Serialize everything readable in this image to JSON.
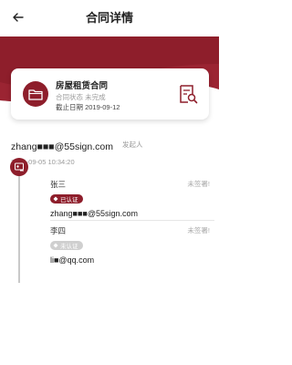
{
  "header": {
    "title": "合同详情"
  },
  "contract": {
    "name": "房屋租赁合同",
    "status": "合同状态 未完成",
    "deadline": "截止日期 2019-09-12"
  },
  "initiator": {
    "email": "zhang■■■@55sign.com",
    "label": "发起人",
    "created_time": "2019-09-05 10:34:20"
  },
  "signers": [
    {
      "name": "张三",
      "badge": "已认证",
      "contact": "zhang■■■@55sign.com",
      "state": "未签署!"
    },
    {
      "name": "李四",
      "badge": "未认证",
      "contact": "li■@qq.com",
      "state": "未签署!"
    }
  ],
  "colors": {
    "brand": "#8e1e2b",
    "muted": "#9a9a9a",
    "timeline": "#c9c9c9"
  },
  "icons": {
    "back": "arrow-left-icon",
    "folder": "folder-icon",
    "preview": "document-search-icon",
    "signer": "signature-icon",
    "verified": "diamond-icon"
  }
}
